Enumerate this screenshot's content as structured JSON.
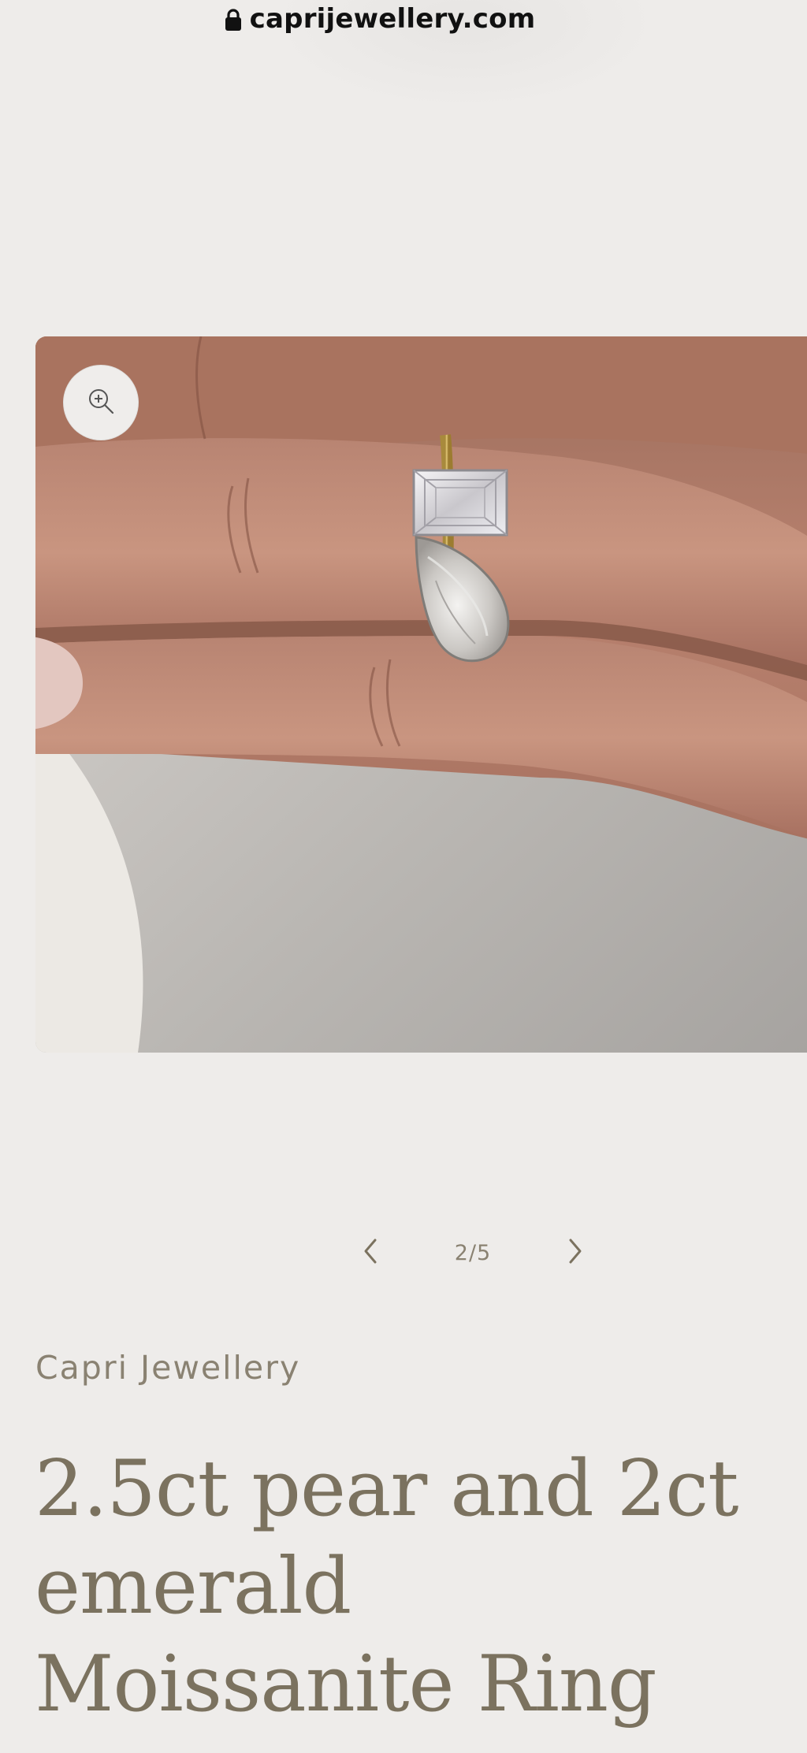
{
  "browser": {
    "url": "caprijewellery.com",
    "lock_icon": "lock-icon"
  },
  "gallery": {
    "image_alt": "2.5ct pear and 2ct emerald Moissanite Ring worn on hand",
    "zoom_icon": "zoom-in-icon"
  },
  "slider": {
    "counter": "2/5",
    "prev_icon": "chevron-left-icon",
    "next_icon": "chevron-right-icon"
  },
  "product": {
    "vendor": "Capri Jewellery",
    "title": "2.5ct pear and 2ct emerald Moissanite Ring"
  },
  "colors": {
    "background": "#eeecea",
    "text": "#7b725f",
    "muted_text": "#8a8272"
  }
}
